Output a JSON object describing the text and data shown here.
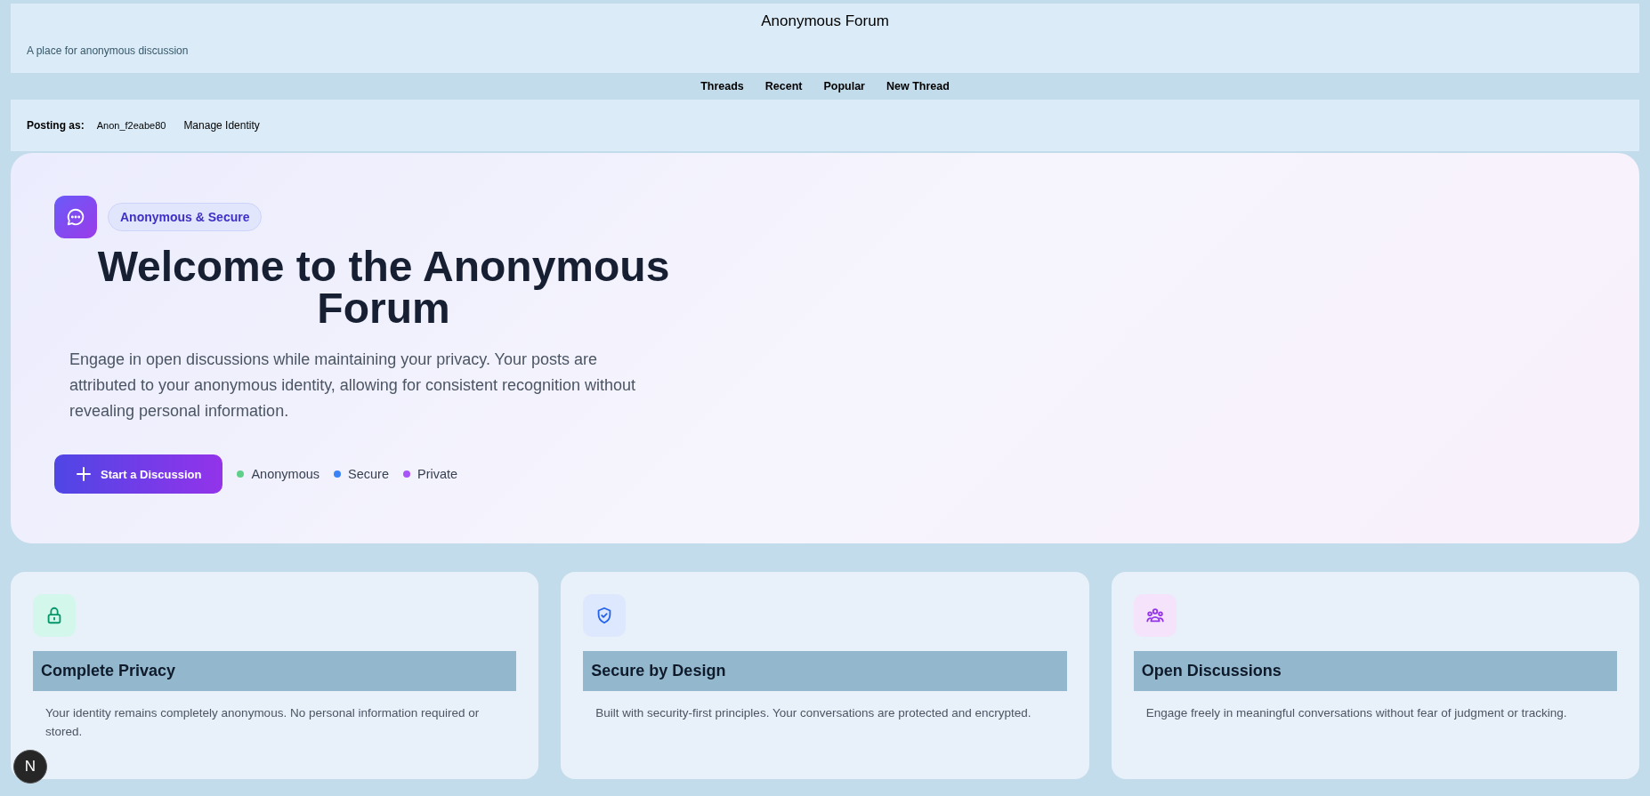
{
  "header": {
    "title": "Anonymous Forum",
    "subtitle": "A place for anonymous discussion"
  },
  "nav": [
    "Threads",
    "Recent",
    "Popular",
    "New Thread"
  ],
  "identity": {
    "label": "Posting as:",
    "name": "Anon_f2eabe80",
    "link": "Manage Identity"
  },
  "hero": {
    "badge": "Anonymous & Secure",
    "heading": "Welcome to the Anonymous Forum",
    "text": "Engage in open discussions while maintaining your privacy. Your posts are attributed to your anonymous identity, allowing for consistent recognition without revealing personal information.",
    "button": "Start a Discussion",
    "tags": [
      {
        "label": "Anonymous",
        "color": "#5fd08a"
      },
      {
        "label": "Secure",
        "color": "#3b82f6"
      },
      {
        "label": "Private",
        "color": "#a855f7"
      }
    ]
  },
  "features": [
    {
      "kind": "lock",
      "title": "Complete Privacy",
      "text": "Your identity remains completely anonymous. No personal information required or stored."
    },
    {
      "kind": "shield",
      "title": "Secure by Design",
      "text": "Built with security-first principles. Your conversations are protected and encrypted."
    },
    {
      "kind": "people",
      "title": "Open Discussions",
      "text": "Engage freely in meaningful conversations without fear of judgment or tracking."
    }
  ],
  "dev_badge": "N"
}
